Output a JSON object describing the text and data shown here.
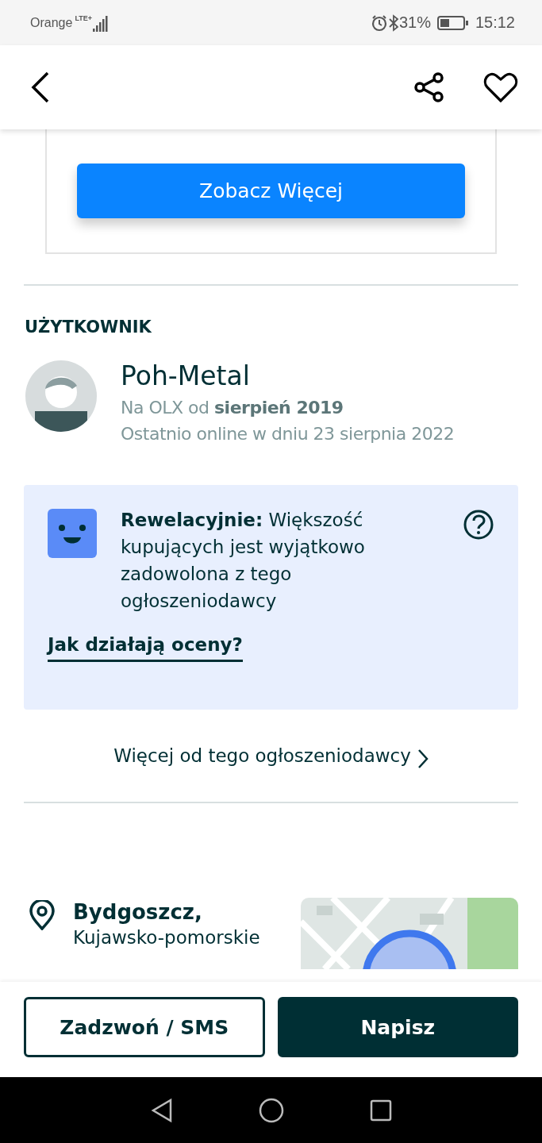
{
  "status_bar": {
    "carrier": "Orange",
    "network": "LTE+",
    "battery": "31%",
    "time": "15:12"
  },
  "header": {
    "favorite": false
  },
  "listing_card": {
    "button": "Zobacz Więcej"
  },
  "user_section": {
    "heading": "UŻYTKOWNIK",
    "name": "Poh-Metal",
    "member_since": "Na OLX od **sierpień 2019**",
    "last_online": "Ostatnio online w dniu 23 sierpnia 2022"
  },
  "rating": {
    "text": "**Rewelacyjnie:** Większość kupujących jest wyjątkowo zadowolona z tego ogłoszeniodawcy",
    "help_link": "Jak działają oceny?"
  },
  "more_link": "Więcej od tego ogłoszeniodawcy",
  "location": {
    "city": "Bydgoszcz,",
    "region": "Kujawsko-pomorskie"
  },
  "actions": [
    {
      "label": "Zadzwoń / SMS",
      "kind": "outline"
    },
    {
      "label": "Napisz",
      "kind": "filled"
    }
  ]
}
